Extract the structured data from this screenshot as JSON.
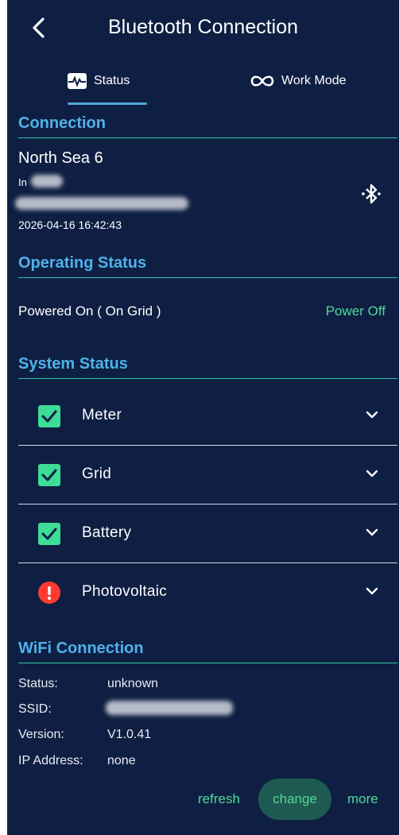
{
  "header": {
    "title": "Bluetooth Connection",
    "back_icon": "chevron-left-icon"
  },
  "tabs": [
    {
      "label": "Status",
      "icon": "pulse-icon"
    },
    {
      "label": "Work Mode",
      "icon": "infinity-icon"
    }
  ],
  "connection": {
    "title": "Connection",
    "device_name": "North Sea 6",
    "location_prefix": "In",
    "timestamp": "2026-04-16 16:42:43",
    "icon": "bluetooth-icon"
  },
  "operating": {
    "title": "Operating Status",
    "status": "Powered On ( On Grid )",
    "power_off": "Power Off"
  },
  "system": {
    "title": "System Status",
    "items": [
      {
        "label": "Meter",
        "state": "ok"
      },
      {
        "label": "Grid",
        "state": "ok"
      },
      {
        "label": "Battery",
        "state": "ok"
      },
      {
        "label": "Photovoltaic",
        "state": "error"
      }
    ]
  },
  "wifi": {
    "title": "WiFi Connection",
    "status_label": "Status:",
    "status": "unknown",
    "ssid_label": "SSID:",
    "version_label": "Version:",
    "version": "V1.0.41",
    "ip_label": "IP Address:",
    "ip": "none"
  },
  "actions": {
    "refresh": "refresh",
    "change": "change",
    "more": "more"
  },
  "colors": {
    "background": "#0f1f43",
    "accent_blue": "#4fb2ea",
    "accent_green": "#4fd89a",
    "ok_green": "#3ddc97",
    "error_red": "#ff3b30"
  }
}
